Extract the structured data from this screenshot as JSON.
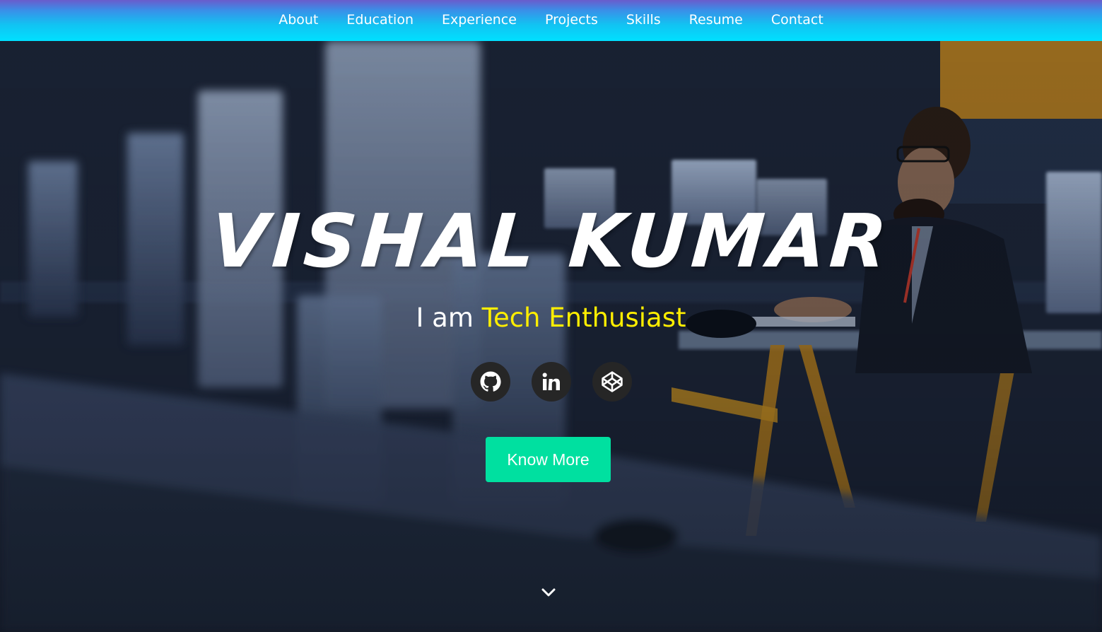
{
  "nav": {
    "items": [
      {
        "label": "About"
      },
      {
        "label": "Education"
      },
      {
        "label": "Experience"
      },
      {
        "label": "Projects"
      },
      {
        "label": "Skills"
      },
      {
        "label": "Resume"
      },
      {
        "label": "Contact"
      }
    ]
  },
  "hero": {
    "name": "VISHAL KUMAR",
    "subtitle_prefix": "I am ",
    "subtitle_typed": "Tech Enthusiast",
    "button_label": "Know More",
    "socials": [
      {
        "icon": "github-icon"
      },
      {
        "icon": "linkedin-icon"
      },
      {
        "icon": "codepen-icon"
      }
    ],
    "scroll_icon": "chevron-down-icon"
  },
  "colors": {
    "nav_gradient_top": "#6a5ccc",
    "nav_gradient_bottom": "#00e0ff",
    "typed_text": "#ffee00",
    "button_bg": "#00e0a0",
    "social_bg": "#262626"
  }
}
